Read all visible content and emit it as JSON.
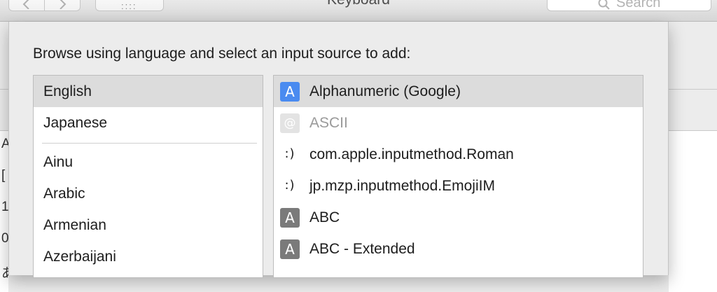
{
  "window": {
    "title": "Keyboard",
    "search_placeholder": "Search",
    "grid_button_dots": "::::"
  },
  "background_glyphs": [
    "A",
    "[",
    "1",
    "0",
    "あ"
  ],
  "sheet": {
    "prompt": "Browse using language and select an input source to add:",
    "languages": {
      "preferred": [
        {
          "label": "English",
          "selected": true
        },
        {
          "label": "Japanese",
          "selected": false
        }
      ],
      "others": [
        {
          "label": "Ainu"
        },
        {
          "label": "Arabic"
        },
        {
          "label": "Armenian"
        },
        {
          "label": "Azerbaijani"
        }
      ]
    },
    "input_sources": [
      {
        "label": "Alphanumeric (Google)",
        "icon": "a-box-blue-icon",
        "icon_text": "A",
        "selected": true,
        "enabled": true
      },
      {
        "label": "ASCII",
        "icon": "at-sign-icon",
        "icon_text": "@",
        "selected": false,
        "enabled": false
      },
      {
        "label": "com.apple.inputmethod.Roman",
        "icon": "smiley-icon",
        "icon_text": ":)",
        "selected": false,
        "enabled": true
      },
      {
        "label": "jp.mzp.inputmethod.EmojiIM",
        "icon": "smiley-icon",
        "icon_text": ":)",
        "selected": false,
        "enabled": true
      },
      {
        "label": "ABC",
        "icon": "a-box-gray-icon",
        "icon_text": "A",
        "selected": false,
        "enabled": true
      },
      {
        "label": "ABC - Extended",
        "icon": "a-box-gray-icon",
        "icon_text": "A",
        "selected": false,
        "enabled": true
      }
    ]
  },
  "colors": {
    "selection": "#dcdcdc",
    "accent_icon": "#4a8bf0",
    "gray_icon": "#7a7a7a"
  }
}
